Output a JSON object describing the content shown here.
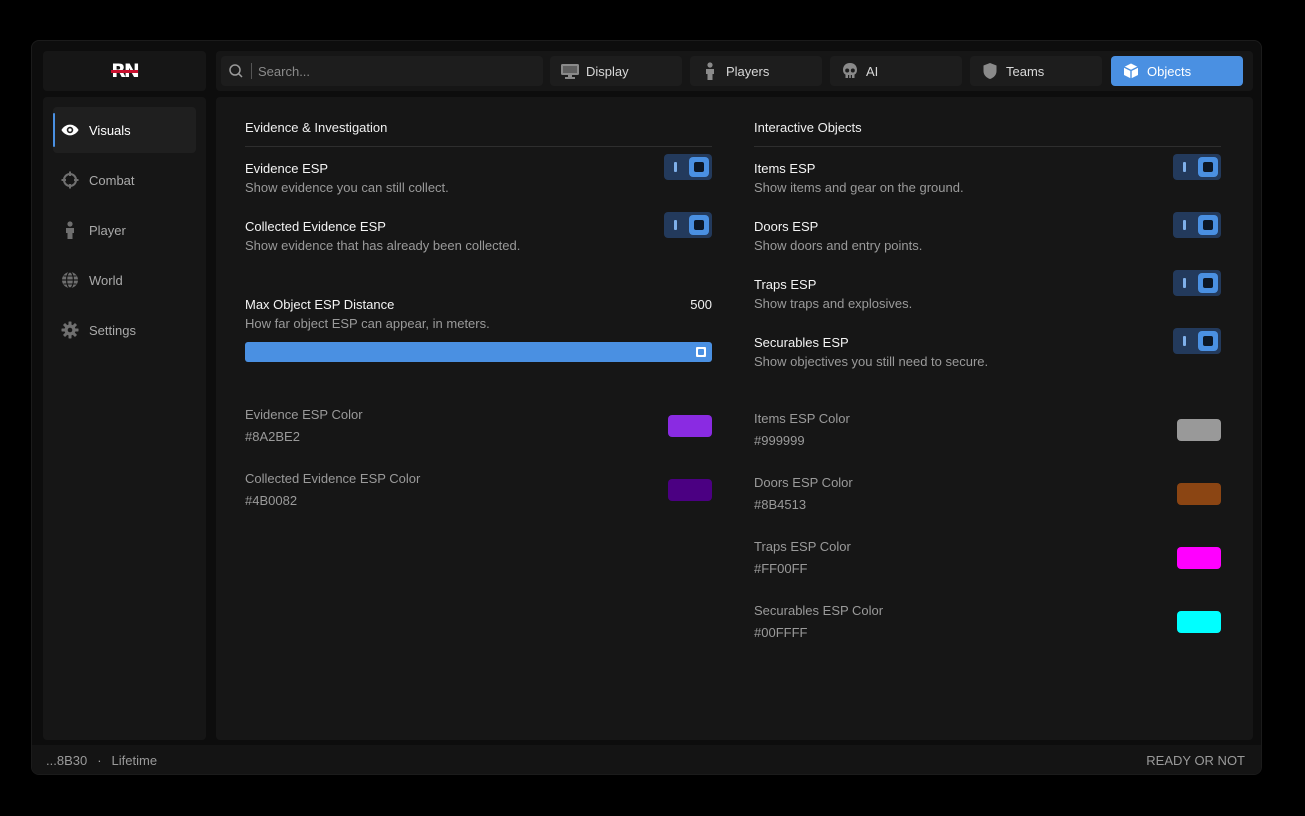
{
  "logo": {
    "text": "RN"
  },
  "search": {
    "placeholder": "Search..."
  },
  "tabs": [
    {
      "label": "Display",
      "icon": "monitor-icon"
    },
    {
      "label": "Players",
      "icon": "person-icon"
    },
    {
      "label": "AI",
      "icon": "skull-icon"
    },
    {
      "label": "Teams",
      "icon": "shield-icon"
    },
    {
      "label": "Objects",
      "icon": "cube-icon",
      "active": true
    }
  ],
  "sidebar": {
    "items": [
      {
        "label": "Visuals",
        "icon": "eye-icon",
        "active": true
      },
      {
        "label": "Combat",
        "icon": "crosshair-icon"
      },
      {
        "label": "Player",
        "icon": "person-icon"
      },
      {
        "label": "World",
        "icon": "globe-icon"
      },
      {
        "label": "Settings",
        "icon": "gear-icon"
      }
    ]
  },
  "left": {
    "title": "Evidence & Investigation",
    "options": [
      {
        "title": "Evidence ESP",
        "desc": "Show evidence you can still collect.",
        "enabled": true
      },
      {
        "title": "Collected Evidence ESP",
        "desc": "Show evidence that has already been collected.",
        "enabled": true
      }
    ],
    "slider": {
      "title": "Max Object ESP Distance",
      "desc": "How far object ESP can appear, in meters.",
      "value": "500",
      "fraction": 1.0
    },
    "colors": [
      {
        "label": "Evidence ESP Color",
        "hex": "#8A2BE2"
      },
      {
        "label": "Collected Evidence ESP Color",
        "hex": "#4B0082"
      }
    ]
  },
  "right": {
    "title": "Interactive Objects",
    "options": [
      {
        "title": "Items ESP",
        "desc": "Show items and gear on the ground.",
        "enabled": true
      },
      {
        "title": "Doors ESP",
        "desc": "Show doors and entry points.",
        "enabled": true
      },
      {
        "title": "Traps ESP",
        "desc": "Show traps and explosives.",
        "enabled": true
      },
      {
        "title": "Securables ESP",
        "desc": "Show objectives you still need to secure.",
        "enabled": true
      }
    ],
    "colors": [
      {
        "label": "Items ESP Color",
        "hex": "#999999"
      },
      {
        "label": "Doors ESP Color",
        "hex": "#8B4513"
      },
      {
        "label": "Traps ESP Color",
        "hex": "#FF00FF"
      },
      {
        "label": "Securables ESP Color",
        "hex": "#00FFFF"
      }
    ]
  },
  "footer": {
    "user_id": "...8B30",
    "separator": "·",
    "license": "Lifetime",
    "game": "READY OR NOT"
  },
  "colors": {
    "accent": "#4a90e2",
    "panel": "#161616",
    "background": "#0d0d0d"
  }
}
